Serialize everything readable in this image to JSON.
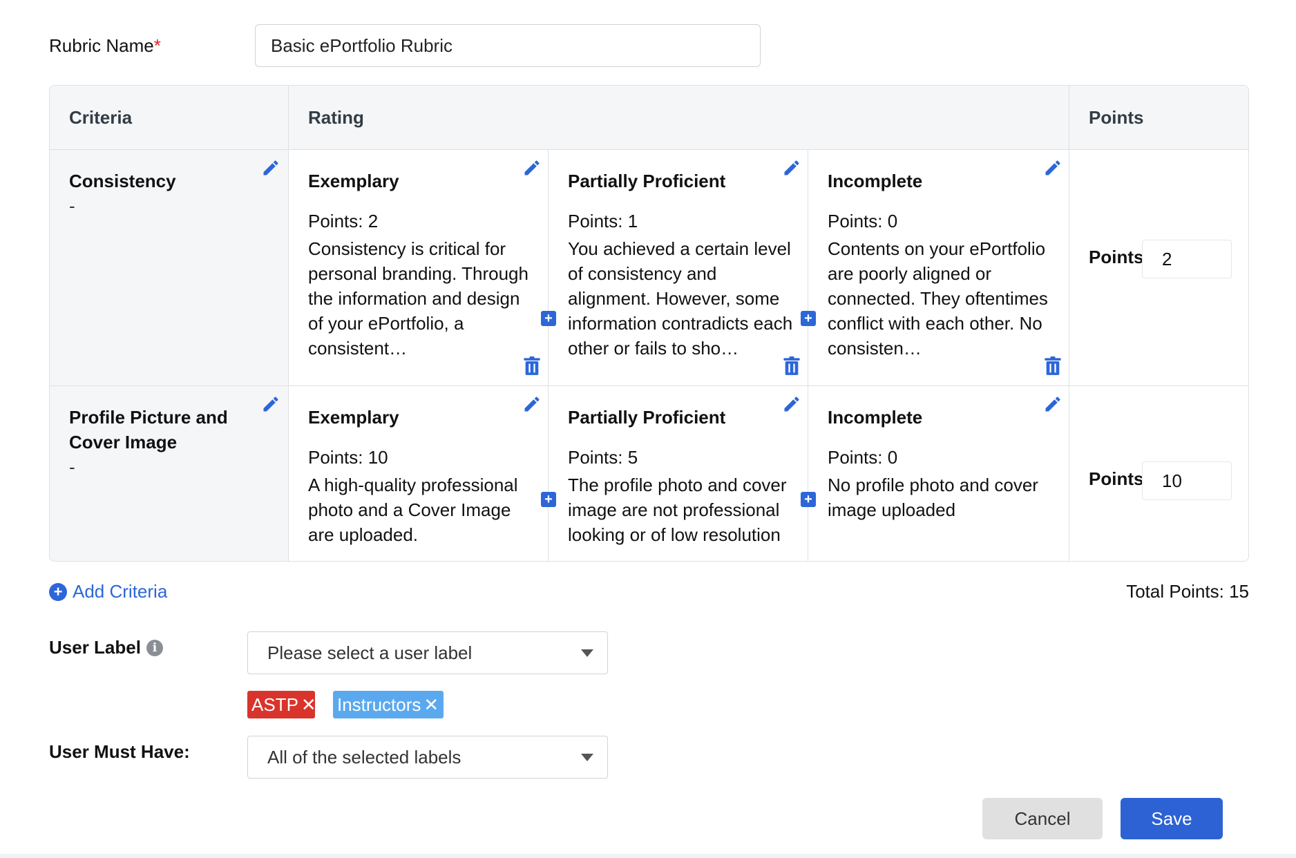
{
  "rubric_name": {
    "label": "Rubric Name",
    "required_mark": "*",
    "value": "Basic ePortfolio Rubric"
  },
  "table": {
    "headers": {
      "criteria": "Criteria",
      "rating": "Rating",
      "points": "Points"
    },
    "rows": [
      {
        "criterion": "Consistency",
        "description": "-",
        "ratings": [
          {
            "title": "Exemplary",
            "points": "Points: 2",
            "description": "Consistency is critical for personal branding. Through the information and design of your ePortfolio, a consistent…"
          },
          {
            "title": "Partially Proficient",
            "points": "Points: 1",
            "description": "You achieved a certain level of consistency and alignment. However, some information contradicts each other or fails to sho…"
          },
          {
            "title": "Incomplete",
            "points": "Points: 0",
            "description": "Contents on your ePortfolio are poorly aligned or connected. They oftentimes conflict with each other. No consisten…"
          }
        ],
        "points_label": "Points",
        "points_value": "2"
      },
      {
        "criterion": "Profile Picture and Cover Image",
        "description": "-",
        "ratings": [
          {
            "title": "Exemplary",
            "points": "Points: 10",
            "description": "A high-quality professional photo and a Cover Image are uploaded."
          },
          {
            "title": "Partially Proficient",
            "points": "Points: 5",
            "description": "The profile photo and cover image are not professional looking or of low resolution"
          },
          {
            "title": "Incomplete",
            "points": "Points: 0",
            "description": "No profile photo and cover image uploaded"
          }
        ],
        "points_label": "Points",
        "points_value": "10"
      }
    ]
  },
  "add_criteria_label": "Add Criteria",
  "total_points": "Total Points: 15",
  "user_label": {
    "label": "User Label",
    "placeholder": "Please select a user label",
    "tags": [
      {
        "text": "ASTP",
        "color": "#d9342b"
      },
      {
        "text": "Instructors",
        "color": "#5aa9ef"
      }
    ]
  },
  "user_must_have": {
    "label": "User Must Have:",
    "value": "All of the selected labels"
  },
  "buttons": {
    "cancel": "Cancel",
    "save": "Save"
  },
  "colors": {
    "accent": "#2c66d8",
    "save": "#2c62d4",
    "required": "#d9262a"
  },
  "icons": {
    "edit": "pencil-icon",
    "delete": "trash-icon",
    "add": "plus-icon",
    "info": "info-icon",
    "remove": "close-icon"
  }
}
